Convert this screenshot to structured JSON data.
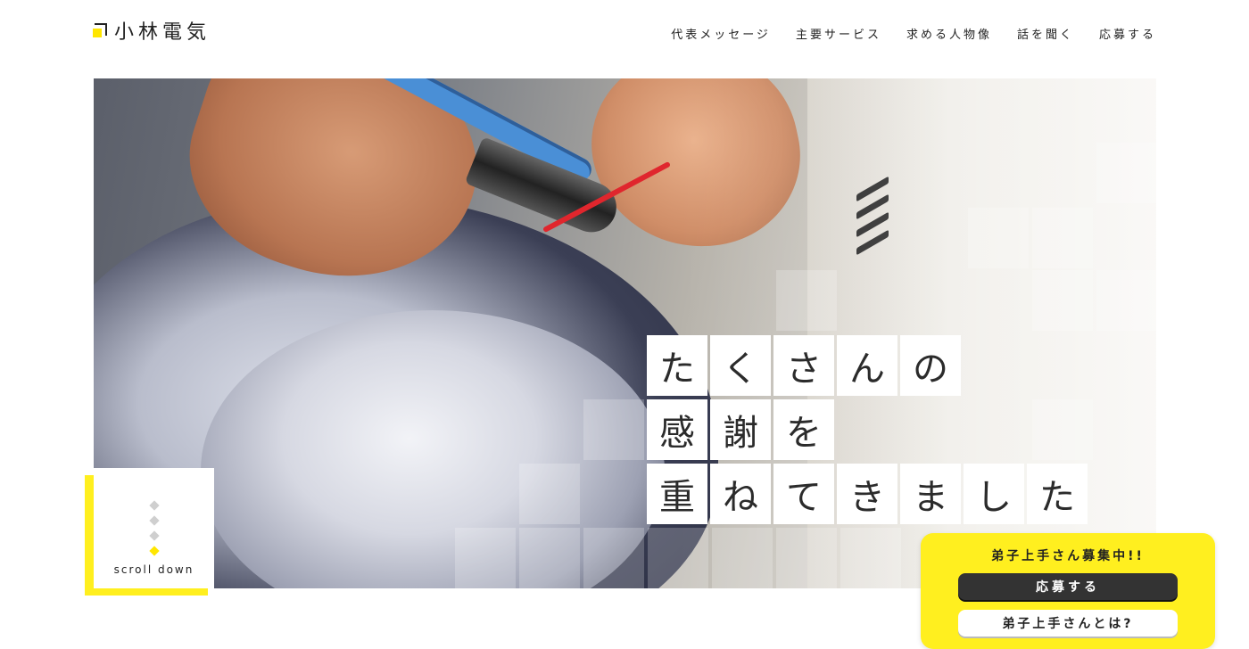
{
  "header": {
    "logo_text": "小林電気",
    "nav": [
      {
        "label": "代表メッセージ"
      },
      {
        "label": "主要サービス"
      },
      {
        "label": "求める人物像"
      },
      {
        "label": "話を聞く"
      },
      {
        "label": "応募する"
      }
    ]
  },
  "hero": {
    "catchphrase_lines": [
      [
        "た",
        "く",
        "さ",
        "ん",
        "の"
      ],
      [
        "感",
        "謝",
        "を"
      ],
      [
        "重",
        "ね",
        "て",
        "き",
        "ま",
        "し",
        "た"
      ]
    ]
  },
  "scroll": {
    "label": "scroll down"
  },
  "recruit": {
    "title": "弟子上手さん募集中!!",
    "apply_label": "応募する",
    "about_label": "弟子上手さんとは?"
  },
  "colors": {
    "accent": "#ffe600",
    "dark_button": "#333333",
    "text": "#222222"
  }
}
